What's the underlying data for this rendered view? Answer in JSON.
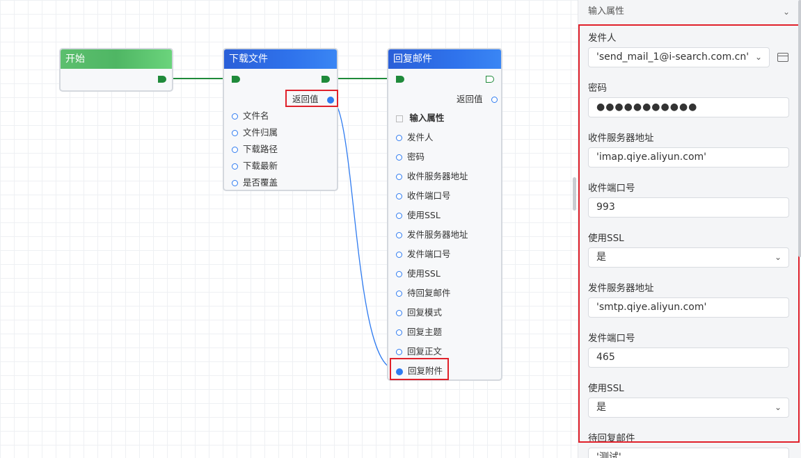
{
  "nodes": {
    "start": {
      "title": "开始"
    },
    "download": {
      "title": "下载文件",
      "return_label": "返回值",
      "inputs": [
        "文件名",
        "文件归属",
        "下载路径",
        "下载最新",
        "是否覆盖"
      ]
    },
    "reply": {
      "title": "回复邮件",
      "return_label": "返回值",
      "section_label": "输入属性",
      "inputs": [
        "发件人",
        "密码",
        "收件服务器地址",
        "收件端口号",
        "使用SSL",
        "发件服务器地址",
        "发件端口号",
        "使用SSL",
        "待回复邮件",
        "回复模式",
        "回复主题",
        "回复正文",
        "回复附件"
      ]
    }
  },
  "panel": {
    "header": "输入属性",
    "fields": [
      {
        "label": "发件人",
        "value": "'send_mail_1@i-search.com.cn'",
        "kind": "select"
      },
      {
        "label": "密码",
        "value": "●●●●●●●●●●●",
        "kind": "password"
      },
      {
        "label": "收件服务器地址",
        "value": "'imap.qiye.aliyun.com'",
        "kind": "text"
      },
      {
        "label": "收件端口号",
        "value": "993",
        "kind": "text"
      },
      {
        "label": "使用SSL",
        "value": "是",
        "kind": "select"
      },
      {
        "label": "发件服务器地址",
        "value": "'smtp.qiye.aliyun.com'",
        "kind": "text"
      },
      {
        "label": "发件端口号",
        "value": "465",
        "kind": "text"
      },
      {
        "label": "使用SSL",
        "value": "是",
        "kind": "select"
      },
      {
        "label": "待回复邮件",
        "value": "'测试'",
        "kind": "text"
      }
    ]
  },
  "colors": {
    "accent": "#2f7bf0",
    "flow_wire": "#1f8a3a",
    "highlight": "#e0202a"
  }
}
